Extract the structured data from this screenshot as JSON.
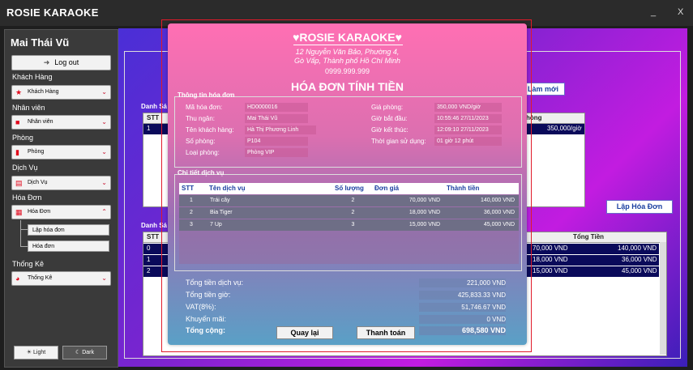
{
  "window": {
    "title": "ROSIE KARAOKE",
    "minimize": "_",
    "close": "X"
  },
  "sidebar": {
    "user_name": "Mai Thái Vũ",
    "logout_label": "Log out",
    "sections": [
      {
        "label": "Khách Hàng",
        "value": "Khách Hàng"
      },
      {
        "label": "Nhân viên",
        "value": "Nhân viên"
      },
      {
        "label": "Phòng",
        "value": "Phòng"
      },
      {
        "label": "Dịch Vụ",
        "value": "Dịch Vụ"
      },
      {
        "label": "Hóa Đơn",
        "value": "Hóa Đơn"
      },
      {
        "label": "Thống Kê",
        "value": "Thống Kê"
      }
    ],
    "invoice_sub": [
      "Lập hóa đơn",
      "Hóa đơn"
    ],
    "theme": {
      "light": "Light",
      "dark": "Dark"
    }
  },
  "background": {
    "table1_label": "Danh Sá",
    "table2_label": "Danh Sá",
    "btn_new": "Làm mới",
    "btn_create_invoice": "Lập Hóa Đơn",
    "table1": {
      "headers": [
        "STT",
        "hòng"
      ],
      "rows": [
        {
          "stt": "1",
          "price": "350,000/giờ"
        }
      ]
    },
    "table2": {
      "headers": [
        "STT",
        "Tổng Tiền"
      ],
      "rows": [
        {
          "stt": "0",
          "mid": "70,000 VND",
          "total": "140,000 VND"
        },
        {
          "stt": "1",
          "mid": "18,000 VND",
          "total": "36,000 VND"
        },
        {
          "stt": "2",
          "mid": "15,000 VND",
          "total": "45,000 VND"
        }
      ]
    }
  },
  "invoice": {
    "brand": "♥ROSIE KARAOKE♥",
    "address_line1": "12 Nguyễn Văn Bảo, Phường 4,",
    "address_line2": "Gò Vấp, Thành phố Hồ Chí Minh",
    "phone": "0999.999.999",
    "heading": "HÓA ĐƠN TÍNH TIỀN",
    "info_title": "Thông tin hóa đơn",
    "info": {
      "left": [
        {
          "label": "Mã hóa đơn:",
          "value": "HD0000016"
        },
        {
          "label": "Thu ngân:",
          "value": "Mai Thái Vũ"
        },
        {
          "label": "Tên khách hàng:",
          "value": "Hà Thị Phương Linh"
        },
        {
          "label": "Số phòng:",
          "value": "P104"
        },
        {
          "label": "Loại phòng:",
          "value": "Phòng VIP"
        }
      ],
      "right": [
        {
          "label": "Giá phòng:",
          "value": "350,000 VND/giờ"
        },
        {
          "label": "Giờ bắt đầu:",
          "value": "10:55:46 27/11/2023"
        },
        {
          "label": "Giờ kết thúc:",
          "value": "12:09:10 27/11/2023"
        },
        {
          "label": "Thời gian sử dụng:",
          "value": "01 giờ 12 phút"
        }
      ]
    },
    "services_title": "Chi tiết dịch vụ",
    "services_headers": [
      "STT",
      "Tên dịch vụ",
      "Số lượng",
      "Đơn giá",
      "Thành tiền"
    ],
    "services": [
      {
        "stt": "1",
        "name": "Trái cây",
        "qty": "2",
        "price": "70,000 VND",
        "total": "140,000 VND"
      },
      {
        "stt": "2",
        "name": "Bia Tiger",
        "qty": "2",
        "price": "18,000 VND",
        "total": "36,000 VND"
      },
      {
        "stt": "3",
        "name": "7 Up",
        "qty": "3",
        "price": "15,000 VND",
        "total": "45,000 VND"
      }
    ],
    "summary": [
      {
        "label": "Tổng tiền dịch vụ:",
        "value": "221,000 VND"
      },
      {
        "label": "Tổng tiền giờ:",
        "value": "425,833.33 VND"
      },
      {
        "label": "VAT(8%):",
        "value": "51,746.67 VND"
      },
      {
        "label": "Khuyến mãi:",
        "value": "0 VND"
      },
      {
        "label": "Tổng cộng:",
        "value": "698,580 VND"
      }
    ],
    "btn_back": "Quay lại",
    "btn_pay": "Thanh toán"
  }
}
